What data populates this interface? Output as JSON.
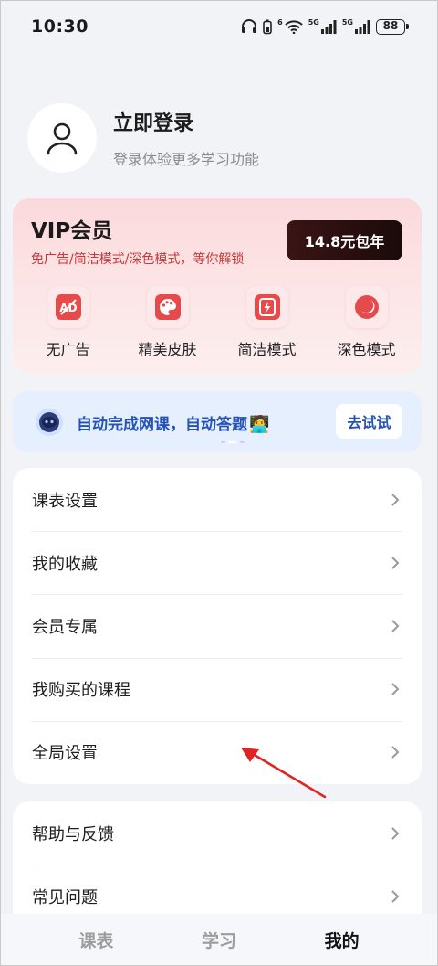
{
  "status_bar": {
    "time": "10:30",
    "network_a": "5G",
    "network_b": "5G",
    "wifi_label": "6",
    "battery": "88"
  },
  "profile": {
    "title": "立即登录",
    "subtitle": "登录体验更多学习功能"
  },
  "vip": {
    "title": "VIP会员",
    "subtitle": "免广告/简洁模式/深色模式，等你解锁",
    "price_button": "14.8元包年",
    "features": [
      {
        "label": "无广告",
        "icon": "no-ads-icon"
      },
      {
        "label": "精美皮肤",
        "icon": "palette-icon"
      },
      {
        "label": "简洁模式",
        "icon": "lightning-icon"
      },
      {
        "label": "深色模式",
        "icon": "moon-icon"
      }
    ],
    "accent_color": "#e64a4a"
  },
  "promo": {
    "text": "自动完成网课，自动答题",
    "emoji": "🧑‍💻",
    "button": "去试试"
  },
  "menu_group_1": [
    {
      "label": "课表设置"
    },
    {
      "label": "我的收藏"
    },
    {
      "label": "会员专属"
    },
    {
      "label": "我购买的课程"
    },
    {
      "label": "全局设置"
    }
  ],
  "menu_group_2": [
    {
      "label": "帮助与反馈"
    },
    {
      "label": "常见问题"
    }
  ],
  "tabs": [
    {
      "label": "课表",
      "active": false
    },
    {
      "label": "学习",
      "active": false
    },
    {
      "label": "我的",
      "active": true
    }
  ]
}
